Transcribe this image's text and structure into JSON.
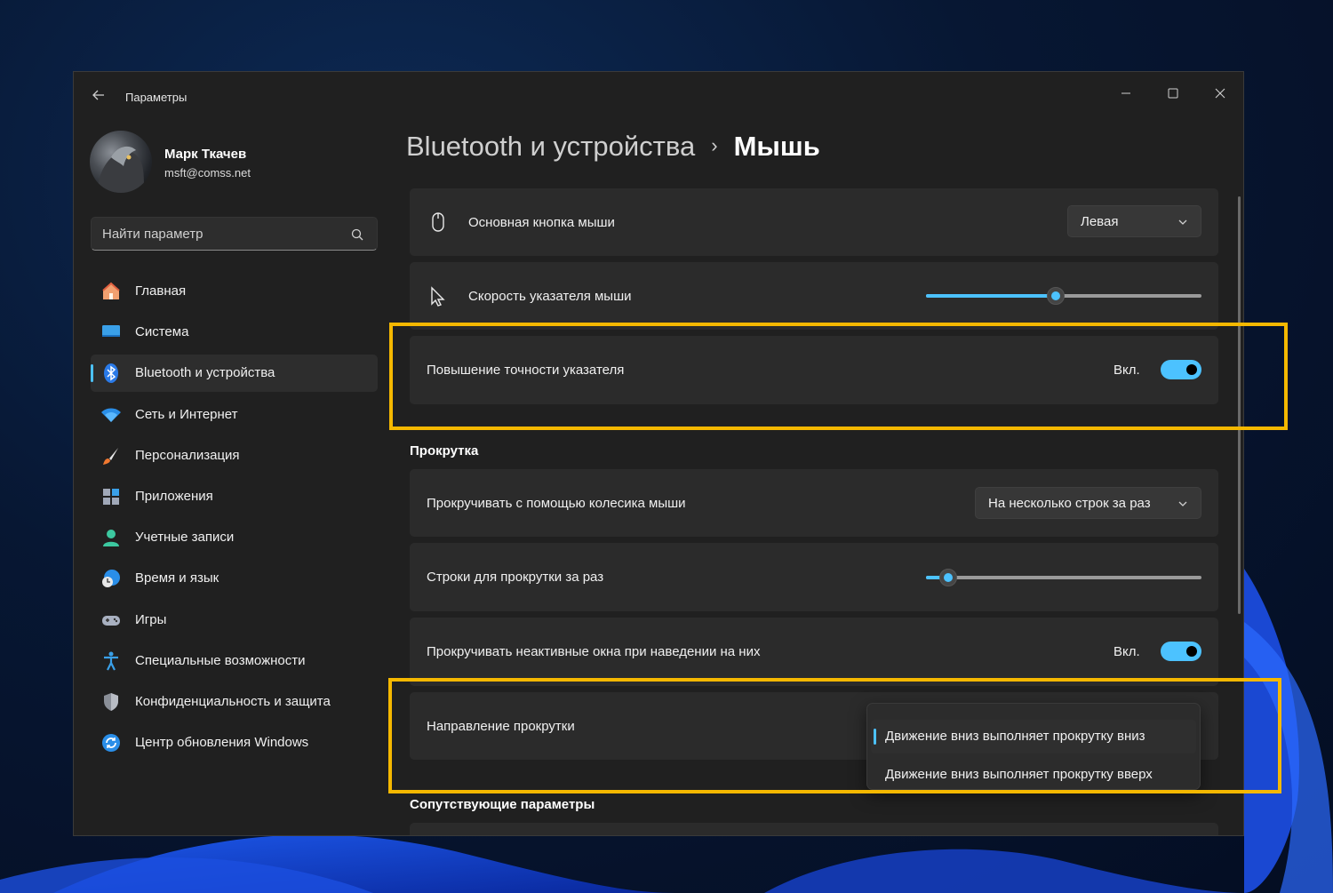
{
  "app": {
    "title": "Параметры"
  },
  "user": {
    "name": "Марк Ткачев",
    "email": "msft@comss.net"
  },
  "search": {
    "placeholder": "Найти параметр"
  },
  "nav": {
    "items": [
      {
        "label": "Главная",
        "icon": "home-icon",
        "active": false
      },
      {
        "label": "Система",
        "icon": "system-icon",
        "active": false
      },
      {
        "label": "Bluetooth и устройства",
        "icon": "bluetooth-icon",
        "active": true
      },
      {
        "label": "Сеть и Интернет",
        "icon": "wifi-icon",
        "active": false
      },
      {
        "label": "Персонализация",
        "icon": "brush-icon",
        "active": false
      },
      {
        "label": "Приложения",
        "icon": "apps-icon",
        "active": false
      },
      {
        "label": "Учетные записи",
        "icon": "account-icon",
        "active": false
      },
      {
        "label": "Время и язык",
        "icon": "time-language-icon",
        "active": false
      },
      {
        "label": "Игры",
        "icon": "gamepad-icon",
        "active": false
      },
      {
        "label": "Специальные возможности",
        "icon": "accessibility-icon",
        "active": false
      },
      {
        "label": "Конфиденциальность и защита",
        "icon": "shield-icon",
        "active": false
      },
      {
        "label": "Центр обновления Windows",
        "icon": "update-icon",
        "active": false
      }
    ]
  },
  "breadcrumb": {
    "parent": "Bluetooth и устройства",
    "separator": "›",
    "current": "Мышь"
  },
  "settings": {
    "primary_button": {
      "label": "Основная кнопка мыши",
      "value": "Левая"
    },
    "pointer_speed": {
      "label": "Скорость указателя мыши",
      "level": 0.47
    },
    "pointer_precision": {
      "label": "Повышение точности указателя",
      "state_text": "Вкл.",
      "on": true
    }
  },
  "scrolling": {
    "section_title": "Прокрутка",
    "wheel_scroll": {
      "label": "Прокручивать с помощью колесика мыши",
      "value": "На несколько строк за раз"
    },
    "lines_per_scroll": {
      "label": "Строки для прокрутки за раз",
      "level": 0.05
    },
    "inactive_scroll": {
      "label": "Прокручивать неактивные окна при наведении на них",
      "state_text": "Вкл.",
      "on": true
    },
    "direction": {
      "label": "Направление прокрутки",
      "options": [
        "Движение вниз выполняет прокрутку вниз",
        "Движение вниз выполняет прокрутку вверх"
      ],
      "selected_index": 0
    }
  },
  "related": {
    "section_title": "Сопутствующие параметры"
  },
  "colors": {
    "accent": "#4cc2ff",
    "highlight": "#f5b800",
    "window_bg": "#202020",
    "card_bg": "#2b2b2b"
  }
}
